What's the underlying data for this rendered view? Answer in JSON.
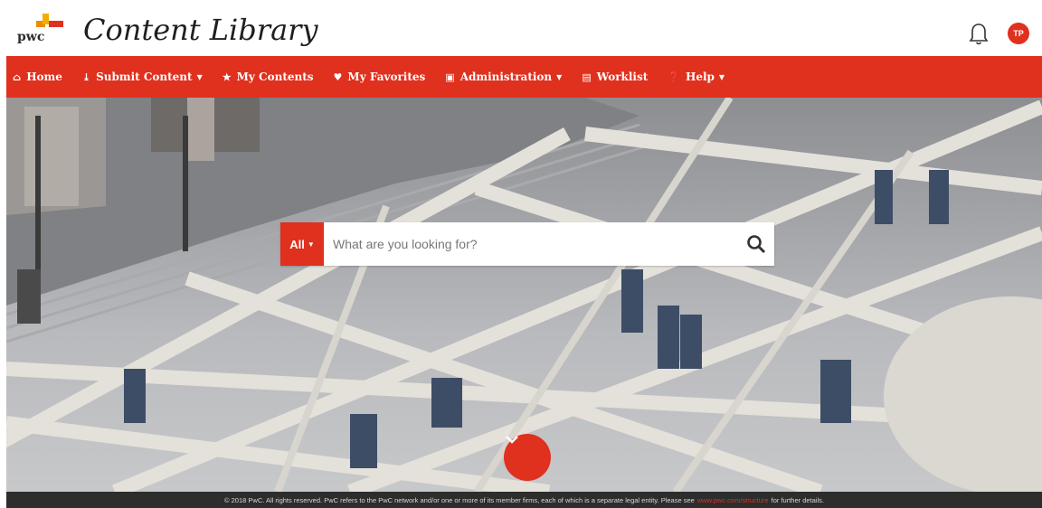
{
  "brand": {
    "logo_text": "pwc",
    "app_title": "Content Library"
  },
  "user": {
    "initials": "TP"
  },
  "nav": {
    "items": [
      {
        "label": "Home",
        "icon": "home-icon",
        "has_dropdown": false
      },
      {
        "label": "Submit Content",
        "icon": "upload-icon",
        "has_dropdown": true
      },
      {
        "label": "My Contents",
        "icon": "star-icon",
        "has_dropdown": false
      },
      {
        "label": "My Favorites",
        "icon": "heart-icon",
        "has_dropdown": false
      },
      {
        "label": "Administration",
        "icon": "id-card-icon",
        "has_dropdown": true
      },
      {
        "label": "Worklist",
        "icon": "list-icon",
        "has_dropdown": false
      },
      {
        "label": "Help",
        "icon": "question-icon",
        "has_dropdown": true
      }
    ]
  },
  "search": {
    "scope": "All",
    "placeholder": "What are you looking for?"
  },
  "footer": {
    "text_before": "© 2018 PwC. All rights reserved. PwC refers to the PwC network and/or one or more of its member firms, each of which is a separate legal entity. Please see",
    "link": "www.pwc.com/structure",
    "text_after": "for further details."
  },
  "colors": {
    "accent": "#e0301e",
    "footer_bg": "#2d2d2d",
    "logo_yellow": "#f0b000",
    "logo_orange": "#eb8c00"
  }
}
